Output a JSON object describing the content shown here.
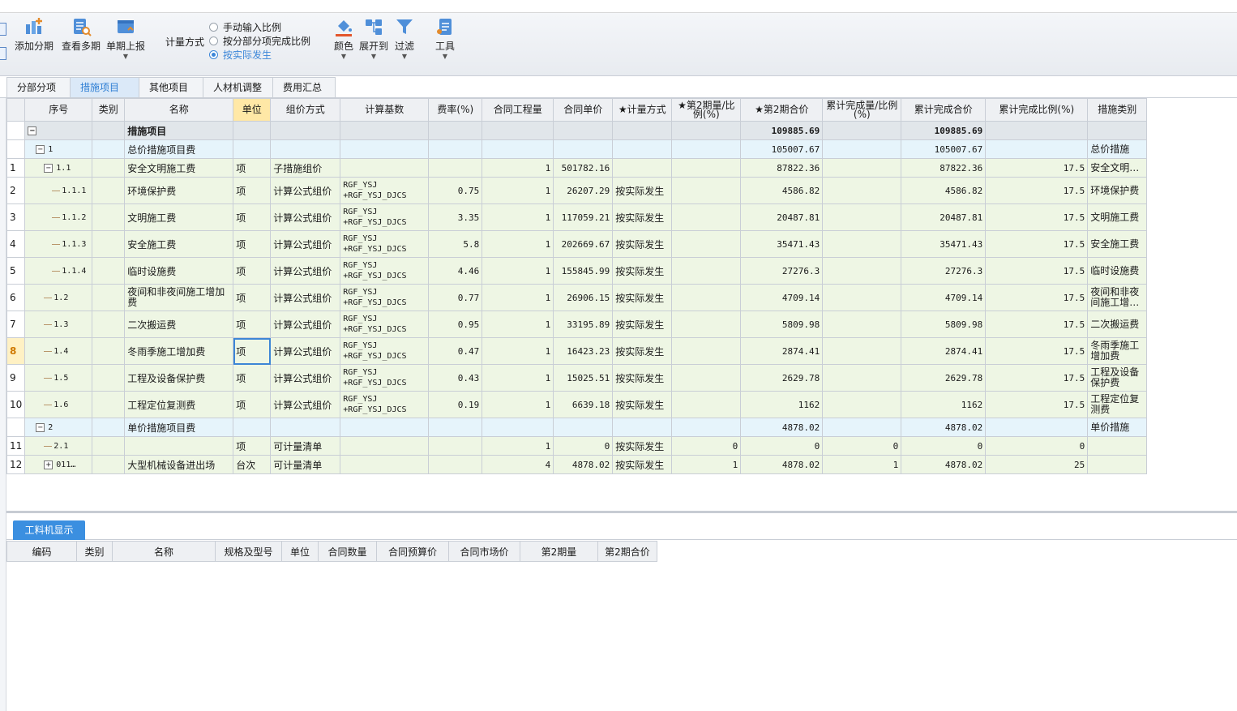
{
  "toolbar": {
    "buttons": {
      "add_period": "添加分期",
      "view_periods": "查看多期",
      "report": "单期上报",
      "color": "颜色",
      "expand": "展开到",
      "filter": "过滤",
      "tools": "工具"
    },
    "measure_label": "计量方式",
    "radios": [
      "手动输入比例",
      "按分部分项完成比例",
      "按实际发生"
    ],
    "selected_radio": "按实际发生"
  },
  "tabs": [
    "分部分项",
    "措施项目",
    "其他项目",
    "人材机调整",
    "费用汇总"
  ],
  "active_tab": "措施项目",
  "grid": {
    "headers": [
      "序号",
      "类别",
      "名称",
      "单位",
      "组价方式",
      "计算基数",
      "费率(%)",
      "合同工程量",
      "合同单价",
      "★计量方式",
      "★第2期量/比例(%)",
      "★第2期合价",
      "累计完成量/比例(%)",
      "累计完成合价",
      "累计完成比例(%)",
      "措施类别"
    ],
    "rows": [
      {
        "no": "",
        "seq": "",
        "name": "措施项目",
        "unit": "",
        "method": "",
        "base": "",
        "rate": "",
        "qty": "",
        "price": "",
        "mmode": "",
        "p2q": "",
        "p2t": "109885.69",
        "cq": "",
        "ct": "109885.69",
        "cr": "",
        "cat": ""
      },
      {
        "no": "",
        "seq": "1",
        "name": "总价措施项目费",
        "unit": "",
        "method": "",
        "base": "",
        "rate": "",
        "qty": "",
        "price": "",
        "mmode": "",
        "p2q": "",
        "p2t": "105007.67",
        "cq": "",
        "ct": "105007.67",
        "cr": "",
        "cat": "总价措施"
      },
      {
        "no": "1",
        "seq": "1.1",
        "name": "安全文明施工费",
        "unit": "项",
        "method": "子措施组价",
        "base": "",
        "rate": "",
        "qty": "1",
        "price": "501782.16",
        "mmode": "",
        "p2q": "",
        "p2t": "87822.36",
        "cq": "",
        "ct": "87822.36",
        "cr": "17.5",
        "cat": "安全文明…"
      },
      {
        "no": "2",
        "seq": "1.1.1",
        "name": "环境保护费",
        "unit": "项",
        "method": "计算公式组价",
        "base": "RGF_YSJ +RGF_YSJ_DJCS",
        "rate": "0.75",
        "qty": "1",
        "price": "26207.29",
        "mmode": "按实际发生",
        "p2q": "",
        "p2t": "4586.82",
        "cq": "",
        "ct": "4586.82",
        "cr": "17.5",
        "cat": "环境保护费"
      },
      {
        "no": "3",
        "seq": "1.1.2",
        "name": "文明施工费",
        "unit": "项",
        "method": "计算公式组价",
        "base": "RGF_YSJ +RGF_YSJ_DJCS",
        "rate": "3.35",
        "qty": "1",
        "price": "117059.21",
        "mmode": "按实际发生",
        "p2q": "",
        "p2t": "20487.81",
        "cq": "",
        "ct": "20487.81",
        "cr": "17.5",
        "cat": "文明施工费"
      },
      {
        "no": "4",
        "seq": "1.1.3",
        "name": "安全施工费",
        "unit": "项",
        "method": "计算公式组价",
        "base": "RGF_YSJ +RGF_YSJ_DJCS",
        "rate": "5.8",
        "qty": "1",
        "price": "202669.67",
        "mmode": "按实际发生",
        "p2q": "",
        "p2t": "35471.43",
        "cq": "",
        "ct": "35471.43",
        "cr": "17.5",
        "cat": "安全施工费"
      },
      {
        "no": "5",
        "seq": "1.1.4",
        "name": "临时设施费",
        "unit": "项",
        "method": "计算公式组价",
        "base": "RGF_YSJ +RGF_YSJ_DJCS",
        "rate": "4.46",
        "qty": "1",
        "price": "155845.99",
        "mmode": "按实际发生",
        "p2q": "",
        "p2t": "27276.3",
        "cq": "",
        "ct": "27276.3",
        "cr": "17.5",
        "cat": "临时设施费"
      },
      {
        "no": "6",
        "seq": "1.2",
        "name": "夜间和非夜间施工增加费",
        "unit": "项",
        "method": "计算公式组价",
        "base": "RGF_YSJ +RGF_YSJ_DJCS",
        "rate": "0.77",
        "qty": "1",
        "price": "26906.15",
        "mmode": "按实际发生",
        "p2q": "",
        "p2t": "4709.14",
        "cq": "",
        "ct": "4709.14",
        "cr": "17.5",
        "cat": "夜间和非夜间施工增…"
      },
      {
        "no": "7",
        "seq": "1.3",
        "name": "二次搬运费",
        "unit": "项",
        "method": "计算公式组价",
        "base": "RGF_YSJ +RGF_YSJ_DJCS",
        "rate": "0.95",
        "qty": "1",
        "price": "33195.89",
        "mmode": "按实际发生",
        "p2q": "",
        "p2t": "5809.98",
        "cq": "",
        "ct": "5809.98",
        "cr": "17.5",
        "cat": "二次搬运费"
      },
      {
        "no": "8",
        "seq": "1.4",
        "name": "冬雨季施工增加费",
        "unit": "项",
        "method": "计算公式组价",
        "base": "RGF_YSJ +RGF_YSJ_DJCS",
        "rate": "0.47",
        "qty": "1",
        "price": "16423.23",
        "mmode": "按实际发生",
        "p2q": "",
        "p2t": "2874.41",
        "cq": "",
        "ct": "2874.41",
        "cr": "17.5",
        "cat": "冬雨季施工增加费"
      },
      {
        "no": "9",
        "seq": "1.5",
        "name": "工程及设备保护费",
        "unit": "项",
        "method": "计算公式组价",
        "base": "RGF_YSJ +RGF_YSJ_DJCS",
        "rate": "0.43",
        "qty": "1",
        "price": "15025.51",
        "mmode": "按实际发生",
        "p2q": "",
        "p2t": "2629.78",
        "cq": "",
        "ct": "2629.78",
        "cr": "17.5",
        "cat": "工程及设备保护费"
      },
      {
        "no": "10",
        "seq": "1.6",
        "name": "工程定位复测费",
        "unit": "项",
        "method": "计算公式组价",
        "base": "RGF_YSJ +RGF_YSJ_DJCS",
        "rate": "0.19",
        "qty": "1",
        "price": "6639.18",
        "mmode": "按实际发生",
        "p2q": "",
        "p2t": "1162",
        "cq": "",
        "ct": "1162",
        "cr": "17.5",
        "cat": "工程定位复测费"
      },
      {
        "no": "",
        "seq": "2",
        "name": "单价措施项目费",
        "unit": "",
        "method": "",
        "base": "",
        "rate": "",
        "qty": "",
        "price": "",
        "mmode": "",
        "p2q": "",
        "p2t": "4878.02",
        "cq": "",
        "ct": "4878.02",
        "cr": "",
        "cat": "单价措施"
      },
      {
        "no": "11",
        "seq": "2.1",
        "name": "",
        "unit": "项",
        "method": "可计量清单",
        "base": "",
        "rate": "",
        "qty": "1",
        "price": "0",
        "mmode": "按实际发生",
        "p2q": "0",
        "p2t": "0",
        "cq": "0",
        "ct": "0",
        "cr": "0",
        "cat": ""
      },
      {
        "no": "12",
        "seq": "011…",
        "name": "大型机械设备进出场",
        "unit": "台次",
        "method": "可计量清单",
        "base": "",
        "rate": "",
        "qty": "4",
        "price": "4878.02",
        "mmode": "按实际发生",
        "p2q": "1",
        "p2t": "4878.02",
        "cq": "1",
        "ct": "4878.02",
        "cr": "25",
        "cat": ""
      }
    ]
  },
  "bottom": {
    "tab": "工料机显示",
    "headers": [
      "编码",
      "类别",
      "名称",
      "规格及型号",
      "单位",
      "合同数量",
      "合同预算价",
      "合同市场价",
      "第2期量",
      "第2期合价"
    ]
  }
}
